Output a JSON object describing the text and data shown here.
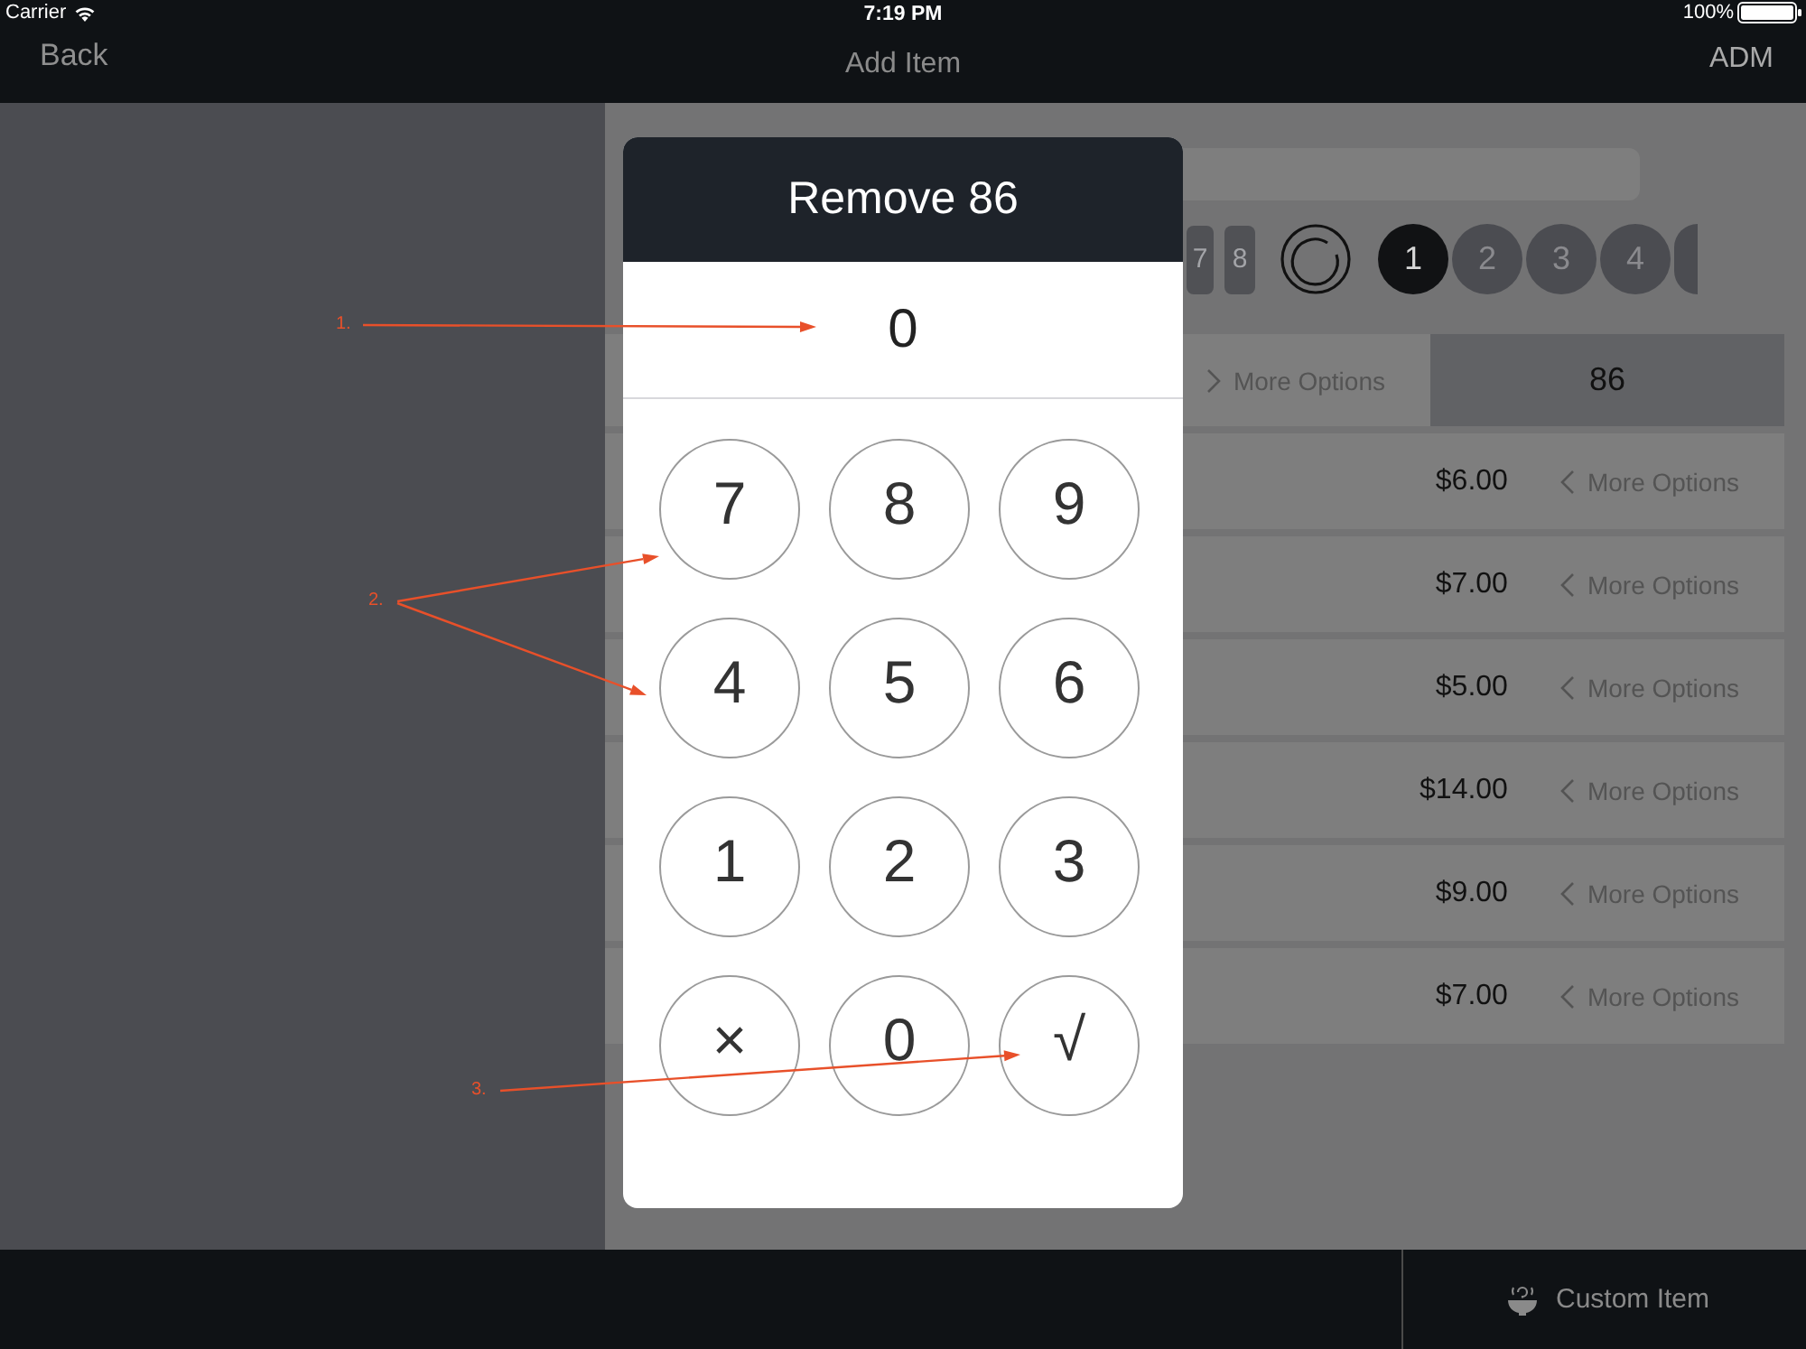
{
  "status_bar": {
    "carrier": "Carrier",
    "time": "7:19 PM",
    "battery": "100%"
  },
  "nav_bar": {
    "back": "Back",
    "title": "Add Item",
    "user": "ADM"
  },
  "tiles": [
    {
      "label": "7"
    },
    {
      "label": "8"
    }
  ],
  "number_buttons": [
    {
      "label": "1",
      "selected": true
    },
    {
      "label": "2",
      "selected": false
    },
    {
      "label": "3",
      "selected": false
    },
    {
      "label": "4",
      "selected": false
    }
  ],
  "items": [
    {
      "kind": "swiped",
      "more": "More Options",
      "action": "86"
    },
    {
      "kind": "item",
      "price": "$6.00",
      "more": "More Options"
    },
    {
      "kind": "item",
      "price": "$7.00",
      "more": "More Options"
    },
    {
      "kind": "item",
      "price": "$5.00",
      "more": "More Options"
    },
    {
      "kind": "item",
      "price": "$14.00",
      "more": "More Options"
    },
    {
      "kind": "item",
      "price": "$9.00",
      "more": "More Options"
    },
    {
      "kind": "item",
      "price": "$7.00",
      "more": "More Options"
    }
  ],
  "dialog": {
    "title": "Remove 86",
    "display": "0",
    "keys": [
      "7",
      "8",
      "9",
      "4",
      "5",
      "6",
      "1",
      "2",
      "3",
      "×",
      "0",
      "√"
    ]
  },
  "bottom_bar": {
    "custom_item": "Custom Item"
  },
  "annotations": [
    "1.",
    "2.",
    "3."
  ]
}
